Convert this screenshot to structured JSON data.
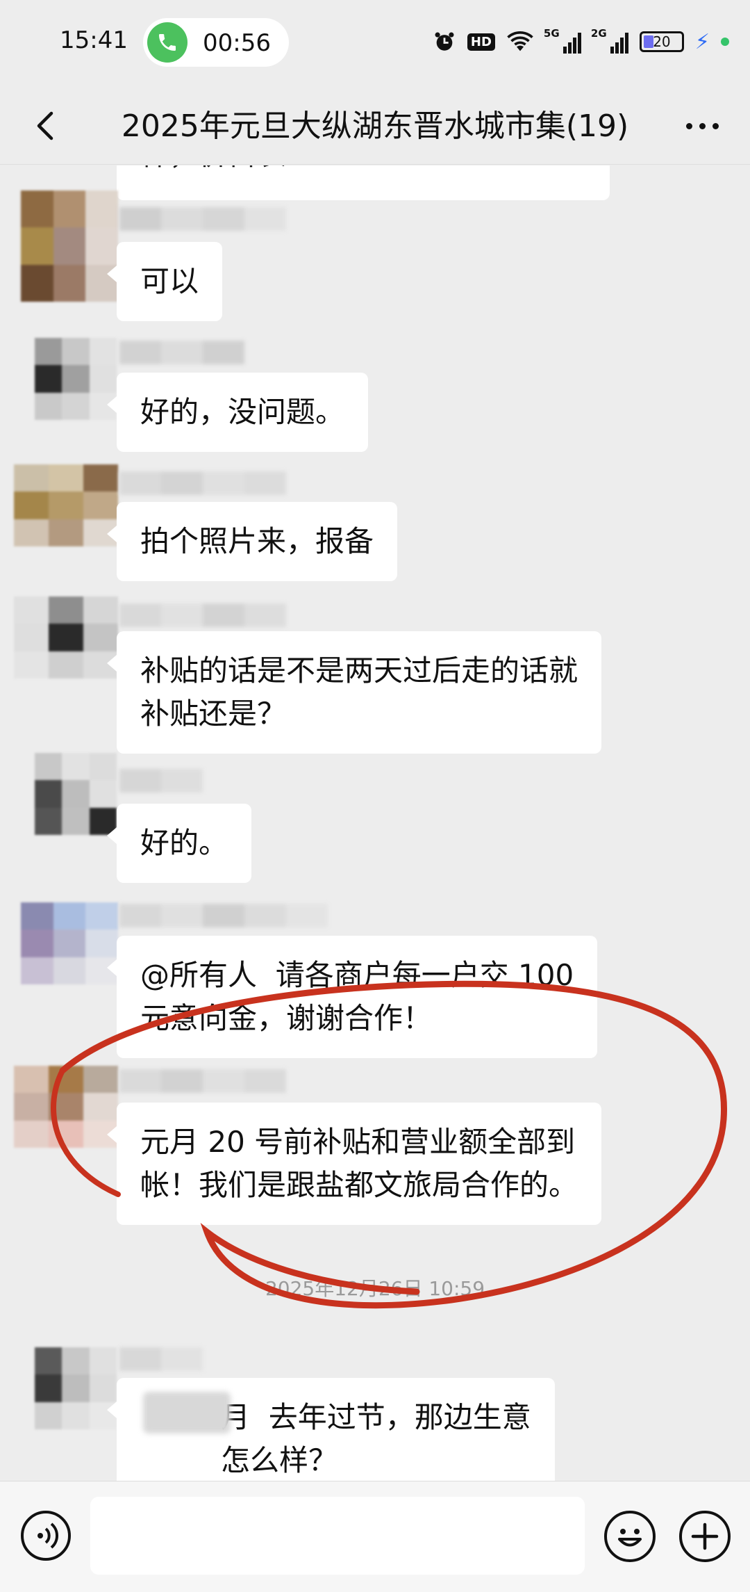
{
  "status_bar": {
    "time": "15:41",
    "call_timer": "00:56",
    "hd_label": "HD",
    "net1_label": "5G",
    "net2_label": "2G",
    "battery_level": "20"
  },
  "header": {
    "title": "2025年元旦大纵湖东晋水城市集(19)"
  },
  "messages": [
    {
      "text": "样，价目表"
    },
    {
      "text": "可以"
    },
    {
      "text": "好的，没问题。"
    },
    {
      "text": "拍个照片来，报备"
    },
    {
      "text": "补贴的话是不是两天过后走的话就\n补贴还是？"
    },
    {
      "text": "好的。"
    },
    {
      "text": "@所有人  请各商户每一户交 100\n元意向金，谢谢合作！"
    },
    {
      "text": "元月 20 号前补贴和营业额全部到\n帐！我们是跟盐都文旅局合作的。"
    },
    {
      "text": "月  去年过节，那边生意\n怎么样？"
    }
  ],
  "timestamp": "2025年12月26日 10:59",
  "colors": {
    "chat_bg": "#ededed",
    "bubble_bg": "#ffffff",
    "annotation_red": "#c8321e",
    "call_green": "#4cc15e"
  },
  "icons": {
    "back": "chevron-left-icon",
    "more": "more-dots-icon",
    "call": "phone-icon",
    "voice": "voice-icon",
    "emoji": "emoji-icon",
    "plus": "plus-icon"
  }
}
